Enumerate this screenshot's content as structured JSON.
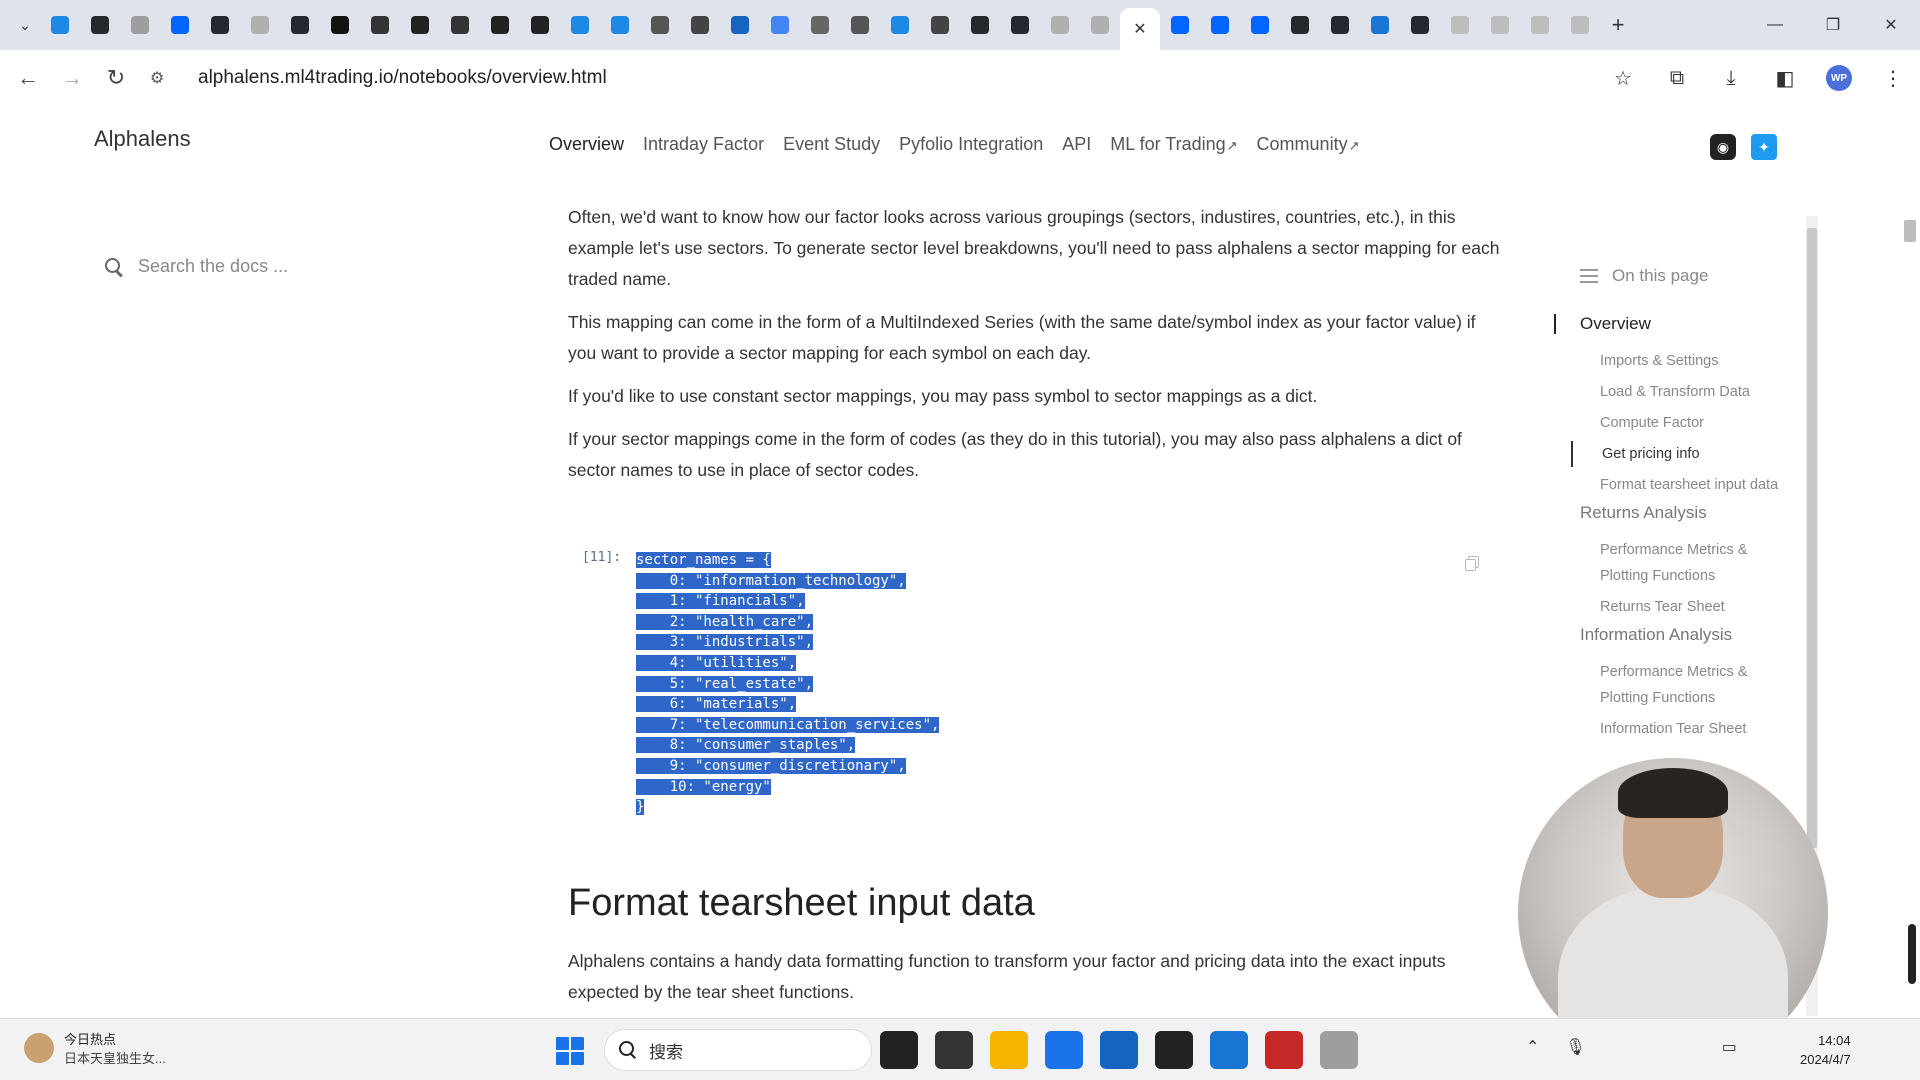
{
  "browser": {
    "tabs": [
      {
        "name": "bilibili",
        "color": "#1e88e5"
      },
      {
        "name": "github",
        "color": "#24292e"
      },
      {
        "name": "circle",
        "color": "#9e9e9e"
      },
      {
        "name": "zhihu",
        "color": "#0066ff"
      },
      {
        "name": "github",
        "color": "#24292e"
      },
      {
        "name": "c-app",
        "color": "#b0b0b0"
      },
      {
        "name": "github",
        "color": "#24292e"
      },
      {
        "name": "notion",
        "color": "#111111"
      },
      {
        "name": "ai",
        "color": "#333333"
      },
      {
        "name": "video",
        "color": "#222222"
      },
      {
        "name": "tds",
        "color": "#333333"
      },
      {
        "name": "slash",
        "color": "#222222"
      },
      {
        "name": "slash",
        "color": "#222222"
      },
      {
        "name": "cloud",
        "color": "#1e88e5"
      },
      {
        "name": "cloud",
        "color": "#1e88e5"
      },
      {
        "name": "person",
        "color": "#555555"
      },
      {
        "name": "book",
        "color": "#444444"
      },
      {
        "name": "paw",
        "color": "#1565c0"
      },
      {
        "name": "google",
        "color": "#4285f4"
      },
      {
        "name": "globe",
        "color": "#666666"
      },
      {
        "name": "bracket",
        "color": "#555555"
      },
      {
        "name": "star",
        "color": "#1e88e5"
      },
      {
        "name": "book",
        "color": "#444444"
      },
      {
        "name": "github",
        "color": "#24292e"
      },
      {
        "name": "github",
        "color": "#24292e"
      },
      {
        "name": "c-app",
        "color": "#b0b0b0"
      },
      {
        "name": "c-app",
        "color": "#b0b0b0"
      }
    ],
    "tabs_after": [
      {
        "name": "zhihu",
        "color": "#0066ff"
      },
      {
        "name": "zhihu",
        "color": "#0066ff"
      },
      {
        "name": "zhihu",
        "color": "#0066ff"
      },
      {
        "name": "github",
        "color": "#24292e"
      },
      {
        "name": "github",
        "color": "#24292e"
      },
      {
        "name": "blue-dot",
        "color": "#1976d2"
      },
      {
        "name": "github",
        "color": "#24292e"
      },
      {
        "name": "loading",
        "color": "#bdbdbd"
      },
      {
        "name": "page",
        "color": "#bdbdbd"
      },
      {
        "name": "page",
        "color": "#bdbdbd"
      },
      {
        "name": "page",
        "color": "#bdbdbd"
      }
    ],
    "url": "alphalens.ml4trading.io/notebooks/overview.html"
  },
  "site": {
    "brand": "Alphalens",
    "nav": [
      {
        "label": "Overview",
        "external": false
      },
      {
        "label": "Intraday Factor",
        "external": false
      },
      {
        "label": "Event Study",
        "external": false
      },
      {
        "label": "Pyfolio Integration",
        "external": false
      },
      {
        "label": "API",
        "external": false
      },
      {
        "label": "ML for Trading",
        "external": true
      },
      {
        "label": "Community",
        "external": true
      }
    ],
    "search_placeholder": "Search the docs ..."
  },
  "content": {
    "paragraphs": [
      "Often, we'd want to know how our factor looks across various groupings (sectors, industires, countries, etc.), in this example let's use sectors. To generate sector level breakdowns, you'll need to pass alphalens a sector mapping for each traded name.",
      "This mapping can come in the form of a MultiIndexed Series (with the same date/symbol index as your factor value) if you want to provide a sector mapping for each symbol on each day.",
      "If you'd like to use constant sector mappings, you may pass symbol to sector mappings as a dict.",
      "If your sector mappings come in the form of codes (as they do in this tutorial), you may also pass alphalens a dict of sector names to use in place of sector codes."
    ],
    "cell_prompt": "[11]:",
    "code_lines": [
      "sector_names = {",
      "    0: \"information_technology\",",
      "    1: \"financials\",",
      "    2: \"health_care\",",
      "    3: \"industrials\",",
      "    4: \"utilities\",",
      "    5: \"real_estate\",",
      "    6: \"materials\",",
      "    7: \"telecommunication_services\",",
      "    8: \"consumer_staples\",",
      "    9: \"consumer_discretionary\",",
      "    10: \"energy\"",
      "}"
    ],
    "section_title": "Format tearsheet input data",
    "section_text": "Alphalens contains a handy data formatting function to transform your factor and pricing data into the exact inputs expected by the tear sheet functions."
  },
  "toc": {
    "heading": "On this page",
    "items": [
      {
        "label": "Overview",
        "level": 1,
        "current": true
      },
      {
        "label": "Imports & Settings",
        "level": 2,
        "current": false
      },
      {
        "label": "Load & Transform Data",
        "level": 2,
        "current": false
      },
      {
        "label": "Compute Factor",
        "level": 2,
        "current": false
      },
      {
        "label": "Get pricing info",
        "level": 2,
        "current": true
      },
      {
        "label": "Format tearsheet input data",
        "level": 2,
        "current": false
      },
      {
        "label": "Returns Analysis",
        "level": 1,
        "current": false
      },
      {
        "label": "Performance Metrics & Plotting Functions",
        "level": 2,
        "current": false
      },
      {
        "label": "Returns Tear Sheet",
        "level": 2,
        "current": false
      },
      {
        "label": "Information Analysis",
        "level": 1,
        "current": false
      },
      {
        "label": "Performance Metrics & Plotting Functions",
        "level": 2,
        "current": false
      },
      {
        "label": "Information Tear Sheet",
        "level": 2,
        "current": false
      }
    ]
  },
  "taskbar": {
    "news_title": "今日热点",
    "news_sub": "日本天皇独生女...",
    "search_label": "搜索",
    "apps": [
      {
        "name": "terminal-icon",
        "color": "#222222"
      },
      {
        "name": "monitor-icon",
        "color": "#333333"
      },
      {
        "name": "folder-icon",
        "color": "#f5b400"
      },
      {
        "name": "chrome-icon",
        "color": "#1a73e8"
      },
      {
        "name": "vscode-icon",
        "color": "#1565c0"
      },
      {
        "name": "cmd-icon",
        "color": "#222222"
      },
      {
        "name": "pointer-app-icon",
        "color": "#1976d2"
      },
      {
        "name": "wps-icon",
        "color": "#c62828"
      },
      {
        "name": "gear-app-icon",
        "color": "#9e9e9e"
      }
    ],
    "time": "14:04",
    "date": "2024/4/7"
  }
}
